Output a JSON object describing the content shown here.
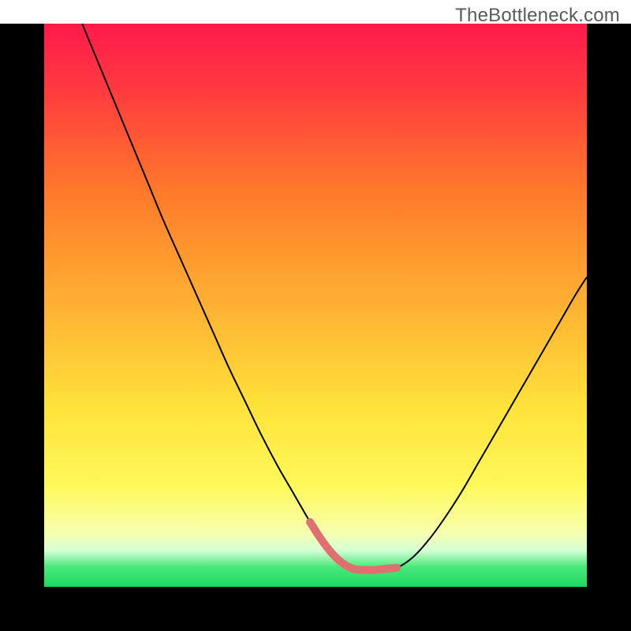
{
  "watermark": "TheBottleneck.com",
  "chart_data": {
    "type": "line",
    "title": "",
    "xlabel": "",
    "ylabel": "",
    "xlim": [
      0,
      100
    ],
    "ylim": [
      0,
      100
    ],
    "background_gradient": {
      "stops": [
        {
          "offset": 0.0,
          "color": "#ff1a4b"
        },
        {
          "offset": 0.12,
          "color": "#ff3b3f"
        },
        {
          "offset": 0.3,
          "color": "#ff7a2a"
        },
        {
          "offset": 0.5,
          "color": "#ffb133"
        },
        {
          "offset": 0.68,
          "color": "#ffe23a"
        },
        {
          "offset": 0.82,
          "color": "#fff95a"
        },
        {
          "offset": 0.905,
          "color": "#f6ffb0"
        },
        {
          "offset": 0.935,
          "color": "#d6ffd6"
        },
        {
          "offset": 0.965,
          "color": "#49e87a"
        },
        {
          "offset": 1.0,
          "color": "#1cd95f"
        }
      ]
    },
    "series": [
      {
        "name": "bottleneck-curve",
        "color": "#000000",
        "width": 2,
        "x": [
          7,
          10,
          13,
          16,
          19,
          22,
          25,
          28,
          31,
          34,
          37,
          40,
          43,
          46,
          49,
          51,
          53,
          55,
          57,
          59,
          62,
          65,
          68,
          71,
          74,
          77,
          80,
          83,
          86,
          89,
          92,
          95,
          98,
          100
        ],
        "y": [
          100,
          93,
          86,
          79,
          72,
          65,
          58.5,
          52,
          45.5,
          39,
          33,
          27,
          21.5,
          16.5,
          11.5,
          8.5,
          6.0,
          4.2,
          3.2,
          3.0,
          3.0,
          3.4,
          5.3,
          8.5,
          12.5,
          17,
          22,
          27,
          32,
          37,
          42,
          47,
          52,
          55
        ]
      },
      {
        "name": "good-zone-highlight",
        "color": "#e07070",
        "width": 10,
        "linecap": "round",
        "x": [
          49,
          51,
          53,
          55,
          57,
          59,
          61,
          63,
          65
        ],
        "y": [
          11.5,
          8.5,
          6.0,
          4.2,
          3.2,
          3.0,
          3.0,
          3.2,
          3.4
        ]
      }
    ],
    "frame": {
      "left_right_bottom_width_pct": 7,
      "color": "#000000"
    }
  }
}
